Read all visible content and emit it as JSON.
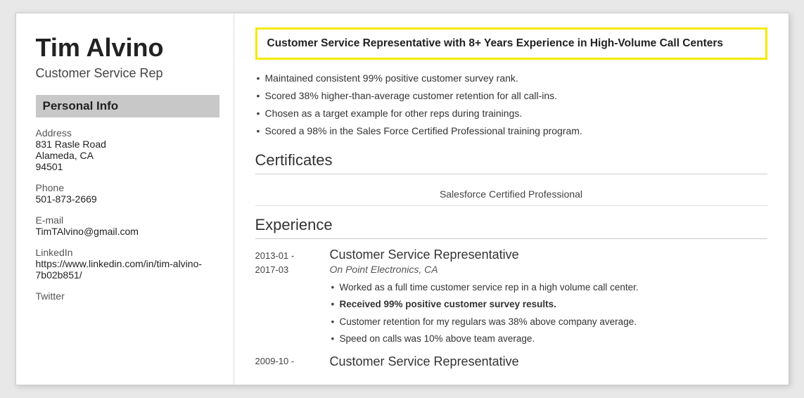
{
  "sidebar": {
    "name": "Tim Alvino",
    "title": "Customer Service Rep",
    "personal_info_header": "Personal Info",
    "address_label": "Address",
    "address_line1": "831 Rasle Road",
    "address_line2": "Alameda, CA",
    "address_line3": "94501",
    "phone_label": "Phone",
    "phone_value": "501-873-2669",
    "email_label": "E-mail",
    "email_value": "TimTAlvino@gmail.com",
    "linkedin_label": "LinkedIn",
    "linkedin_value": "https://www.linkedin.com/in/tim-alvino-7b02b851/",
    "twitter_label": "Twitter"
  },
  "main": {
    "headline": "Customer Service Representative with 8+ Years Experience in High-Volume Call Centers",
    "summary_bullets": [
      "Maintained consistent 99% positive customer survey rank.",
      "Scored 38% higher-than-average customer retention for all call-ins.",
      "Chosen as a target example for other reps during trainings.",
      "Scored a 98% in the Sales Force Certified Professional training program."
    ],
    "certificates_title": "Certificates",
    "certificate_item": "Salesforce Certified Professional",
    "experience_title": "Experience",
    "experience_items": [
      {
        "date_start": "2013-01 -",
        "date_end": "2017-03",
        "job_title": "Customer Service Representative",
        "company": "On Point Electronics, CA",
        "bullets": [
          {
            "text": "Worked as a full time customer service rep in a high volume call center.",
            "bold": false
          },
          {
            "text": "Received 99% positive customer survey results.",
            "bold": true
          },
          {
            "text": "Customer retention for my regulars was 38% above company average.",
            "bold": false
          },
          {
            "text": "Speed on calls was 10% above team average.",
            "bold": false
          }
        ]
      }
    ],
    "experience_next_date": "2009-10 -",
    "experience_next_title": "Customer Service Representative"
  }
}
